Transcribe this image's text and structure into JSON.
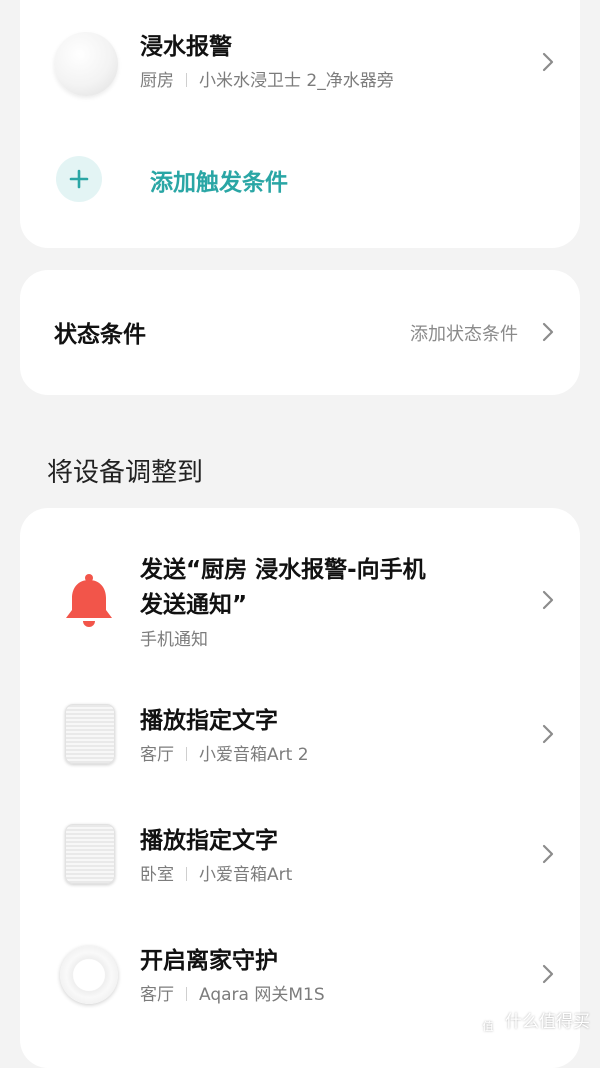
{
  "trigger": {
    "device": {
      "title": "浸水报警",
      "room": "厨房",
      "name": "小米水浸卫士 2_净水器旁",
      "icon": "water-sensor-icon"
    },
    "add_label": "添加触发条件"
  },
  "state": {
    "title": "状态条件",
    "hint": "添加状态条件"
  },
  "actions": {
    "heading": "将设备调整到",
    "items": [
      {
        "title_line1": "发送“厨房 浸水报警-向手机",
        "title_line2": "发送通知”",
        "sub": "手机通知",
        "icon": "bell-icon"
      },
      {
        "title": "播放指定文字",
        "room": "客厅",
        "device": "小爱音箱Art 2",
        "icon": "speaker-icon"
      },
      {
        "title": "播放指定文字",
        "room": "卧室",
        "device": "小爱音箱Art",
        "icon": "speaker-icon"
      },
      {
        "title": "开启离家守护",
        "room": "客厅",
        "device": "Aqara 网关M1S",
        "icon": "gateway-icon"
      }
    ]
  },
  "colors": {
    "accent": "#2aa6a5",
    "bell": "#f2554a",
    "background": "#f3f3f3"
  },
  "watermark": "什么值得买"
}
